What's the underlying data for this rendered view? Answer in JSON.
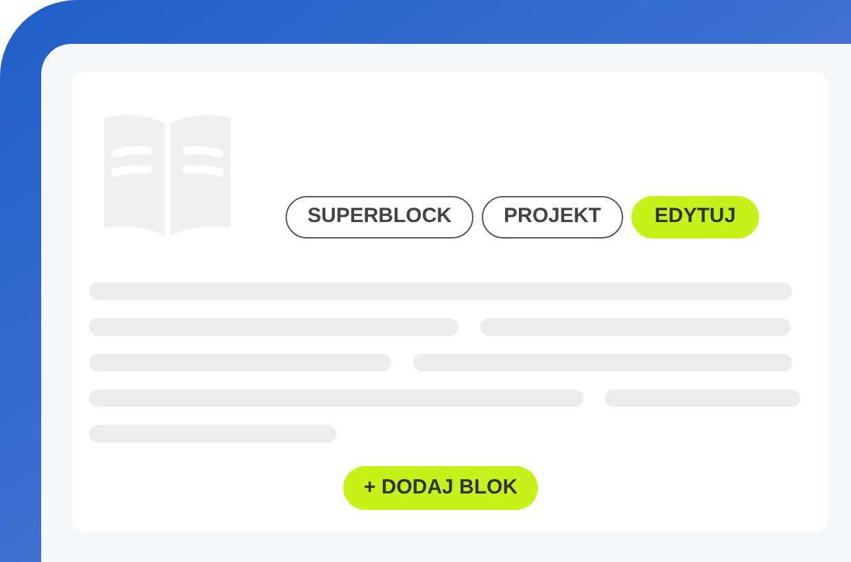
{
  "tags": [
    {
      "label": "SUPERBLOCK",
      "selected": false
    },
    {
      "label": "PROJEKT",
      "selected": false
    },
    {
      "label": "EDYTUJ",
      "selected": true
    }
  ],
  "add_button": {
    "label": "+ DODAJ BLOK"
  }
}
